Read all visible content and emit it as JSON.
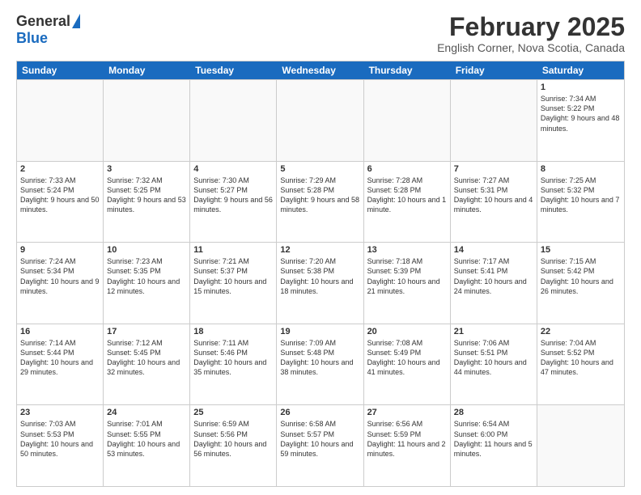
{
  "logo": {
    "part1": "General",
    "part2": "Blue"
  },
  "title": "February 2025",
  "subtitle": "English Corner, Nova Scotia, Canada",
  "weekdays": [
    "Sunday",
    "Monday",
    "Tuesday",
    "Wednesday",
    "Thursday",
    "Friday",
    "Saturday"
  ],
  "weeks": [
    [
      {
        "day": "",
        "info": ""
      },
      {
        "day": "",
        "info": ""
      },
      {
        "day": "",
        "info": ""
      },
      {
        "day": "",
        "info": ""
      },
      {
        "day": "",
        "info": ""
      },
      {
        "day": "",
        "info": ""
      },
      {
        "day": "1",
        "info": "Sunrise: 7:34 AM\nSunset: 5:22 PM\nDaylight: 9 hours and 48 minutes."
      }
    ],
    [
      {
        "day": "2",
        "info": "Sunrise: 7:33 AM\nSunset: 5:24 PM\nDaylight: 9 hours and 50 minutes."
      },
      {
        "day": "3",
        "info": "Sunrise: 7:32 AM\nSunset: 5:25 PM\nDaylight: 9 hours and 53 minutes."
      },
      {
        "day": "4",
        "info": "Sunrise: 7:30 AM\nSunset: 5:27 PM\nDaylight: 9 hours and 56 minutes."
      },
      {
        "day": "5",
        "info": "Sunrise: 7:29 AM\nSunset: 5:28 PM\nDaylight: 9 hours and 58 minutes."
      },
      {
        "day": "6",
        "info": "Sunrise: 7:28 AM\nSunset: 5:28 PM\nDaylight: 10 hours and 1 minute."
      },
      {
        "day": "7",
        "info": "Sunrise: 7:27 AM\nSunset: 5:31 PM\nDaylight: 10 hours and 4 minutes."
      },
      {
        "day": "8",
        "info": "Sunrise: 7:25 AM\nSunset: 5:32 PM\nDaylight: 10 hours and 7 minutes."
      }
    ],
    [
      {
        "day": "9",
        "info": "Sunrise: 7:24 AM\nSunset: 5:34 PM\nDaylight: 10 hours and 9 minutes."
      },
      {
        "day": "10",
        "info": "Sunrise: 7:23 AM\nSunset: 5:35 PM\nDaylight: 10 hours and 12 minutes."
      },
      {
        "day": "11",
        "info": "Sunrise: 7:21 AM\nSunset: 5:37 PM\nDaylight: 10 hours and 15 minutes."
      },
      {
        "day": "12",
        "info": "Sunrise: 7:20 AM\nSunset: 5:38 PM\nDaylight: 10 hours and 18 minutes."
      },
      {
        "day": "13",
        "info": "Sunrise: 7:18 AM\nSunset: 5:39 PM\nDaylight: 10 hours and 21 minutes."
      },
      {
        "day": "14",
        "info": "Sunrise: 7:17 AM\nSunset: 5:41 PM\nDaylight: 10 hours and 24 minutes."
      },
      {
        "day": "15",
        "info": "Sunrise: 7:15 AM\nSunset: 5:42 PM\nDaylight: 10 hours and 26 minutes."
      }
    ],
    [
      {
        "day": "16",
        "info": "Sunrise: 7:14 AM\nSunset: 5:44 PM\nDaylight: 10 hours and 29 minutes."
      },
      {
        "day": "17",
        "info": "Sunrise: 7:12 AM\nSunset: 5:45 PM\nDaylight: 10 hours and 32 minutes."
      },
      {
        "day": "18",
        "info": "Sunrise: 7:11 AM\nSunset: 5:46 PM\nDaylight: 10 hours and 35 minutes."
      },
      {
        "day": "19",
        "info": "Sunrise: 7:09 AM\nSunset: 5:48 PM\nDaylight: 10 hours and 38 minutes."
      },
      {
        "day": "20",
        "info": "Sunrise: 7:08 AM\nSunset: 5:49 PM\nDaylight: 10 hours and 41 minutes."
      },
      {
        "day": "21",
        "info": "Sunrise: 7:06 AM\nSunset: 5:51 PM\nDaylight: 10 hours and 44 minutes."
      },
      {
        "day": "22",
        "info": "Sunrise: 7:04 AM\nSunset: 5:52 PM\nDaylight: 10 hours and 47 minutes."
      }
    ],
    [
      {
        "day": "23",
        "info": "Sunrise: 7:03 AM\nSunset: 5:53 PM\nDaylight: 10 hours and 50 minutes."
      },
      {
        "day": "24",
        "info": "Sunrise: 7:01 AM\nSunset: 5:55 PM\nDaylight: 10 hours and 53 minutes."
      },
      {
        "day": "25",
        "info": "Sunrise: 6:59 AM\nSunset: 5:56 PM\nDaylight: 10 hours and 56 minutes."
      },
      {
        "day": "26",
        "info": "Sunrise: 6:58 AM\nSunset: 5:57 PM\nDaylight: 10 hours and 59 minutes."
      },
      {
        "day": "27",
        "info": "Sunrise: 6:56 AM\nSunset: 5:59 PM\nDaylight: 11 hours and 2 minutes."
      },
      {
        "day": "28",
        "info": "Sunrise: 6:54 AM\nSunset: 6:00 PM\nDaylight: 11 hours and 5 minutes."
      },
      {
        "day": "",
        "info": ""
      }
    ]
  ]
}
